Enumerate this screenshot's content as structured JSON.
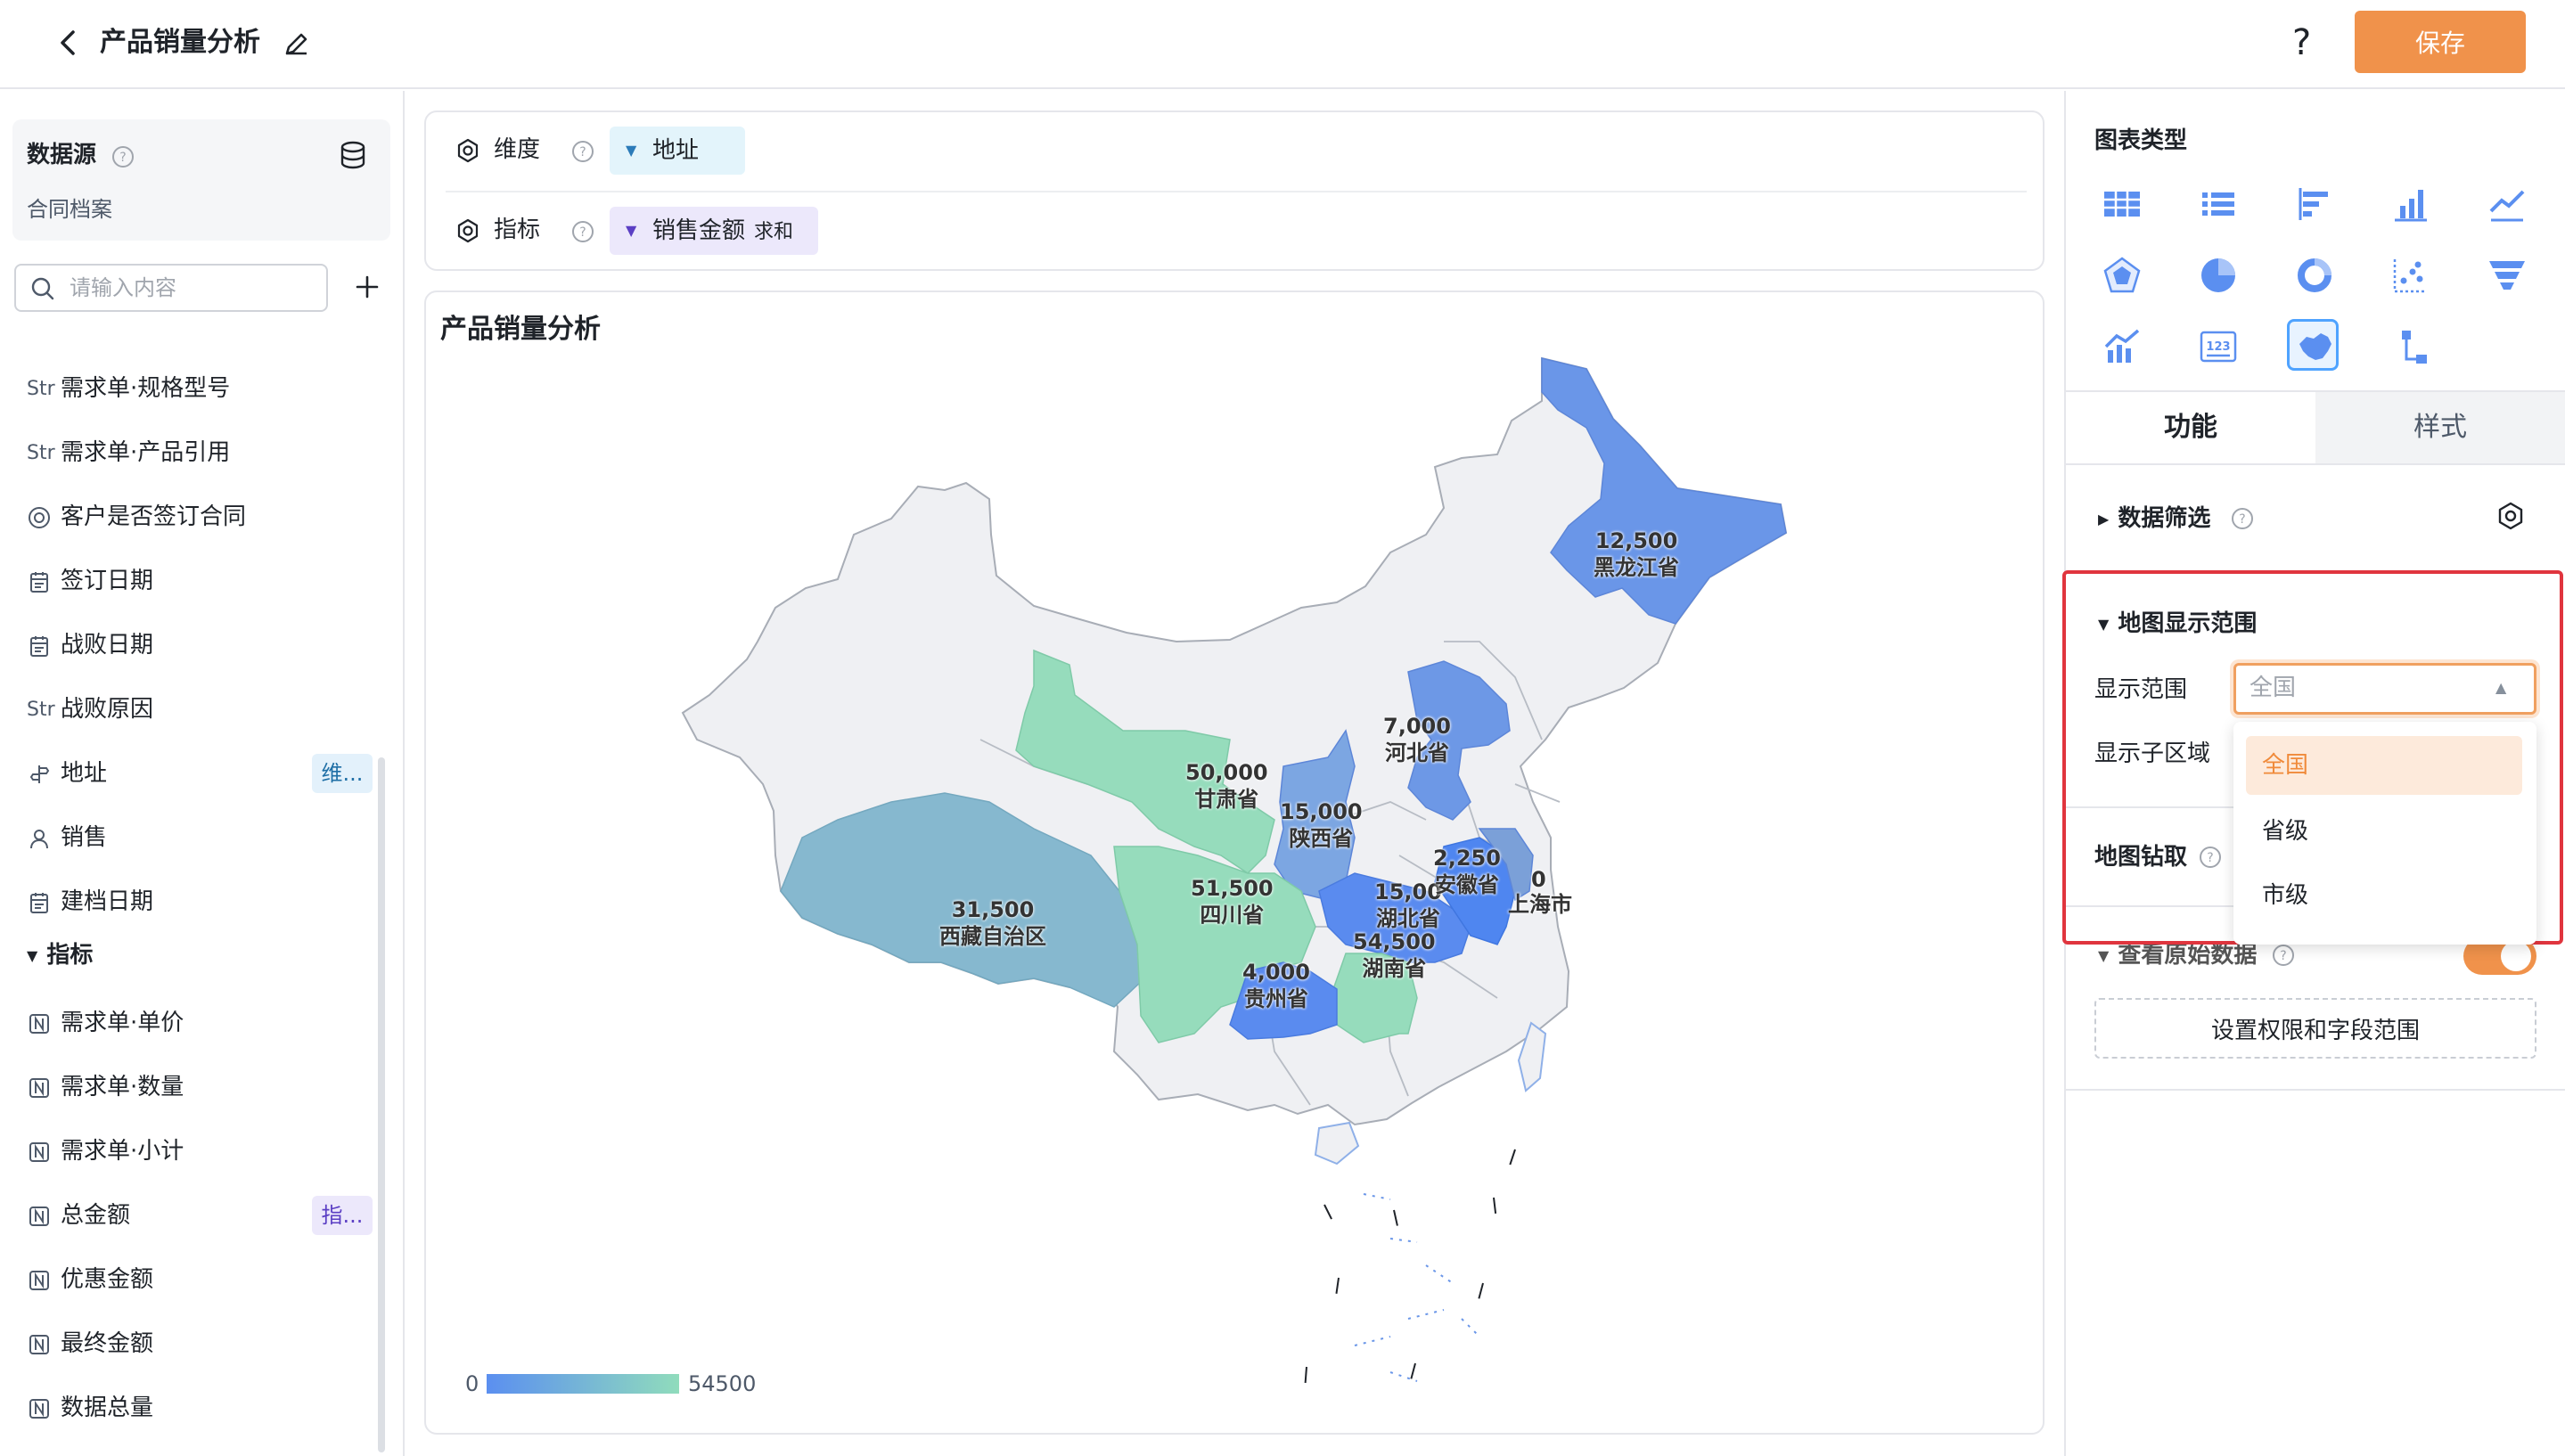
{
  "header": {
    "title": "产品销量分析",
    "help": "?",
    "save_label": "保存"
  },
  "datasource": {
    "title": "数据源",
    "name": "合同档案",
    "search_placeholder": "请输入内容",
    "fields": [
      {
        "type": "Str",
        "label": "需求单·规格型号"
      },
      {
        "type": "Str",
        "label": "需求单·产品引用"
      },
      {
        "type": "radio-icon",
        "label": "客户是否签订合同"
      },
      {
        "type": "date-icon",
        "label": "签订日期"
      },
      {
        "type": "date-icon",
        "label": "战败日期"
      },
      {
        "type": "Str",
        "label": "战败原因"
      },
      {
        "type": "location-icon",
        "label": "地址",
        "tag": "维..."
      },
      {
        "type": "user-icon",
        "label": "销售"
      },
      {
        "type": "date-icon",
        "label": "建档日期"
      }
    ],
    "metrics_group": "指标",
    "metrics": [
      {
        "type": "number-icon",
        "label": "需求单·单价"
      },
      {
        "type": "number-icon",
        "label": "需求单·数量"
      },
      {
        "type": "number-icon",
        "label": "需求单·小计"
      },
      {
        "type": "number-icon",
        "label": "总金额",
        "tag": "指..."
      },
      {
        "type": "number-icon",
        "label": "优惠金额"
      },
      {
        "type": "number-icon",
        "label": "最终金额"
      },
      {
        "type": "number-icon",
        "label": "数据总量"
      }
    ]
  },
  "config": {
    "dimension_label": "维度",
    "dimension_value": "地址",
    "metric_label": "指标",
    "metric_value": "销售金额",
    "metric_agg": "求和"
  },
  "chart": {
    "title": "产品销量分析",
    "legend_min": "0",
    "legend_max": "54500",
    "extra_labels": [
      "0",
      "上海市"
    ]
  },
  "chart_data": {
    "type": "map",
    "title": "产品销量分析",
    "scale": {
      "min": 0,
      "max": 54500,
      "colors": [
        "#5b8ff0",
        "#90dcbc"
      ]
    },
    "regions": [
      {
        "name": "黑龙江省",
        "value": 12500,
        "label": "12,500"
      },
      {
        "name": "河北省",
        "value": 7000,
        "label": "7,000"
      },
      {
        "name": "甘肃省",
        "value": 50000,
        "label": "50,000"
      },
      {
        "name": "陕西省",
        "value": 15000,
        "label": "15,000"
      },
      {
        "name": "西藏自治区",
        "value": 31500,
        "label": "31,500"
      },
      {
        "name": "四川省",
        "value": 51500,
        "label": "51,500"
      },
      {
        "name": "湖北省",
        "value": 15000,
        "label": "15,00"
      },
      {
        "name": "安徽省",
        "value": 22250,
        "label": "2,250"
      },
      {
        "name": "湖南省",
        "value": 54500,
        "label": "54,500"
      },
      {
        "name": "贵州省",
        "value": 4000,
        "label": "4,000"
      }
    ]
  },
  "right_panel": {
    "chart_type_title": "图表类型",
    "chart_types": [
      "table-icon",
      "list-icon",
      "bar-horizontal-icon",
      "bar-vertical-icon",
      "line-icon",
      "radar-icon",
      "pie-icon",
      "donut-icon",
      "scatter-icon",
      "funnel-icon",
      "combo-icon",
      "number-card-icon",
      "map-icon",
      "tree-icon"
    ],
    "tab_function": "功能",
    "tab_style": "样式",
    "filter_title": "数据筛选",
    "map_range_title": "地图显示范围",
    "display_range_label": "显示范围",
    "display_range_value": "全国",
    "sub_region_label": "显示子区域",
    "options": [
      "全国",
      "省级",
      "市级"
    ],
    "drill_title": "地图钻取",
    "raw_data_title": "查看原始数据",
    "permission_button": "设置权限和字段范围",
    "colors": {
      "accent": "#f0924b",
      "highlight": "#e0353e",
      "selected": "#4fa3ff"
    }
  }
}
